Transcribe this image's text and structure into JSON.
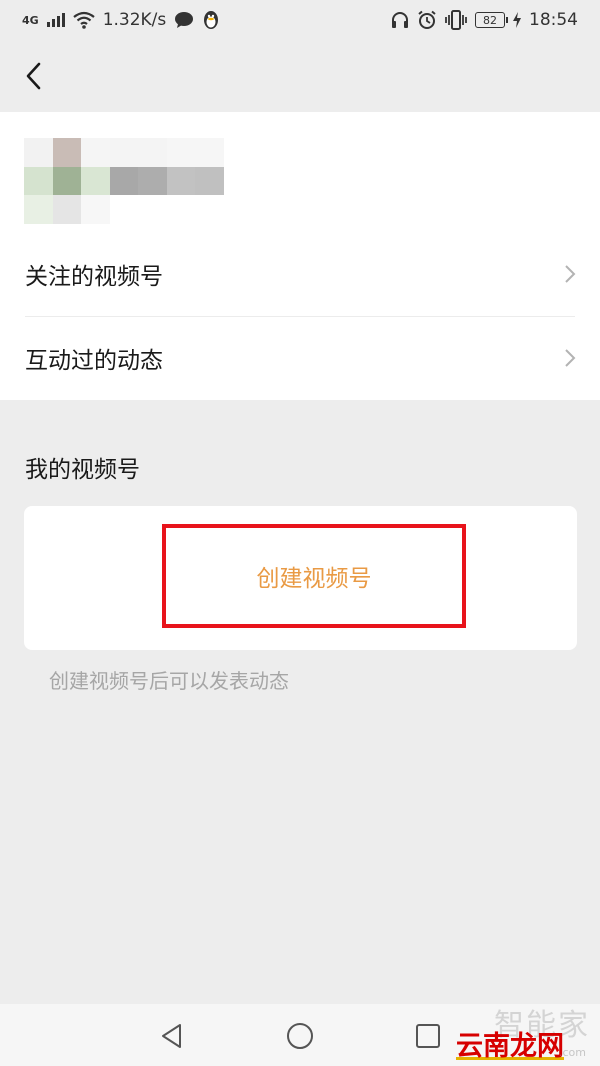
{
  "status_bar": {
    "network": "4G",
    "speed": "1.32K/s",
    "battery": "82",
    "time": "18:54"
  },
  "icons": {
    "back": "back-icon",
    "chevron": "chevron-right-icon",
    "messages": "chat-bubble-icon",
    "qq": "qq-penguin-icon",
    "headphones": "headphones-icon",
    "alarm": "alarm-icon",
    "vibrate": "vibrate-icon",
    "charging": "charging-icon"
  },
  "menu": {
    "items": [
      {
        "label": "关注的视频号"
      },
      {
        "label": "互动过的动态"
      }
    ]
  },
  "my_channels": {
    "title": "我的视频号",
    "create_label": "创建视频号",
    "hint": "创建视频号后可以发表动态"
  },
  "colors": {
    "accent": "#e99a44",
    "highlight": "#e8131b",
    "page_bg": "#ededed"
  },
  "watermark": {
    "main": "云南龙网",
    "faint": "智能家",
    "sub": ".com"
  }
}
